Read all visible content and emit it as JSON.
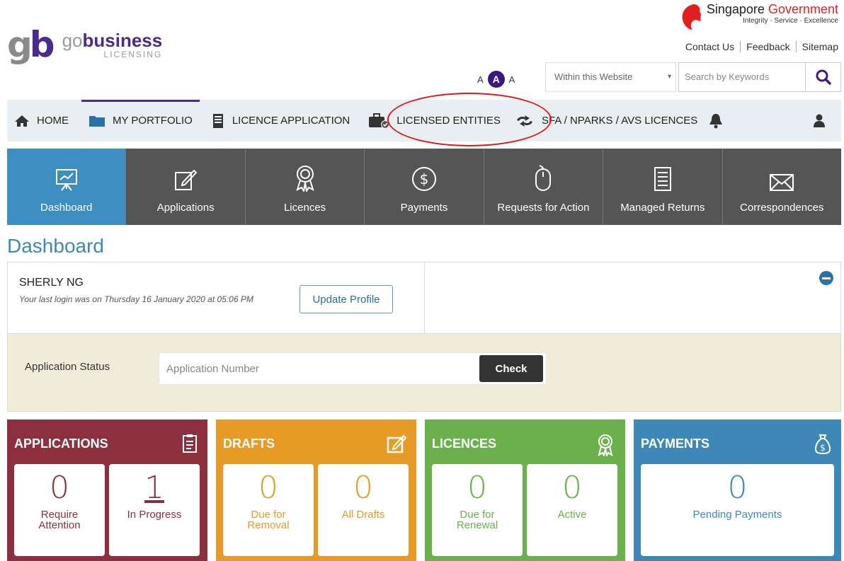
{
  "brand": {
    "name_pre": "go",
    "name_bold": "business",
    "sub": "LICENSING"
  },
  "gov": {
    "t1": "Singapore",
    "t2": "Government",
    "tagline": "Integrity · Service · Excellence"
  },
  "links": [
    "Contact Us",
    "Feedback",
    "Sitemap"
  ],
  "font_sizes": [
    "A",
    "A",
    "A"
  ],
  "search": {
    "scope": "Within this Website",
    "placeholder": "Search by Keywords"
  },
  "nav": [
    "HOME",
    "MY PORTFOLIO",
    "LICENCE APPLICATION",
    "LICENSED ENTITIES",
    "SFA / NPARKS / AVS LICENCES"
  ],
  "tiles": [
    "Dashboard",
    "Applications",
    "Licences",
    "Payments",
    "Requests for Action",
    "Managed Returns",
    "Correspondences"
  ],
  "page_title": "Dashboard",
  "profile": {
    "name": "SHERLY NG",
    "last_login": "Your last login was on Thursday 16 January 2020 at 05:06 PM",
    "update_label": "Update Profile"
  },
  "app_status": {
    "label": "Application Status",
    "placeholder": "Application Number",
    "check_label": "Check"
  },
  "cards": [
    {
      "title": "APPLICATIONS",
      "color": "#8c2f3f",
      "items": [
        {
          "value": "0",
          "label": "Require Attention"
        },
        {
          "value": "1",
          "label": "In Progress"
        }
      ]
    },
    {
      "title": "DRAFTS",
      "color": "#e89a26",
      "items": [
        {
          "value": "0",
          "label": "Due for Removal"
        },
        {
          "value": "0",
          "label": "All Drafts"
        }
      ]
    },
    {
      "title": "LICENCES",
      "color": "#6ab04c",
      "items": [
        {
          "value": "0",
          "label": "Due for Renewal"
        },
        {
          "value": "0",
          "label": "Active"
        }
      ]
    },
    {
      "title": "PAYMENTS",
      "color": "#3e88b8",
      "items": [
        {
          "value": "0",
          "label": "Pending Payments"
        }
      ]
    }
  ]
}
